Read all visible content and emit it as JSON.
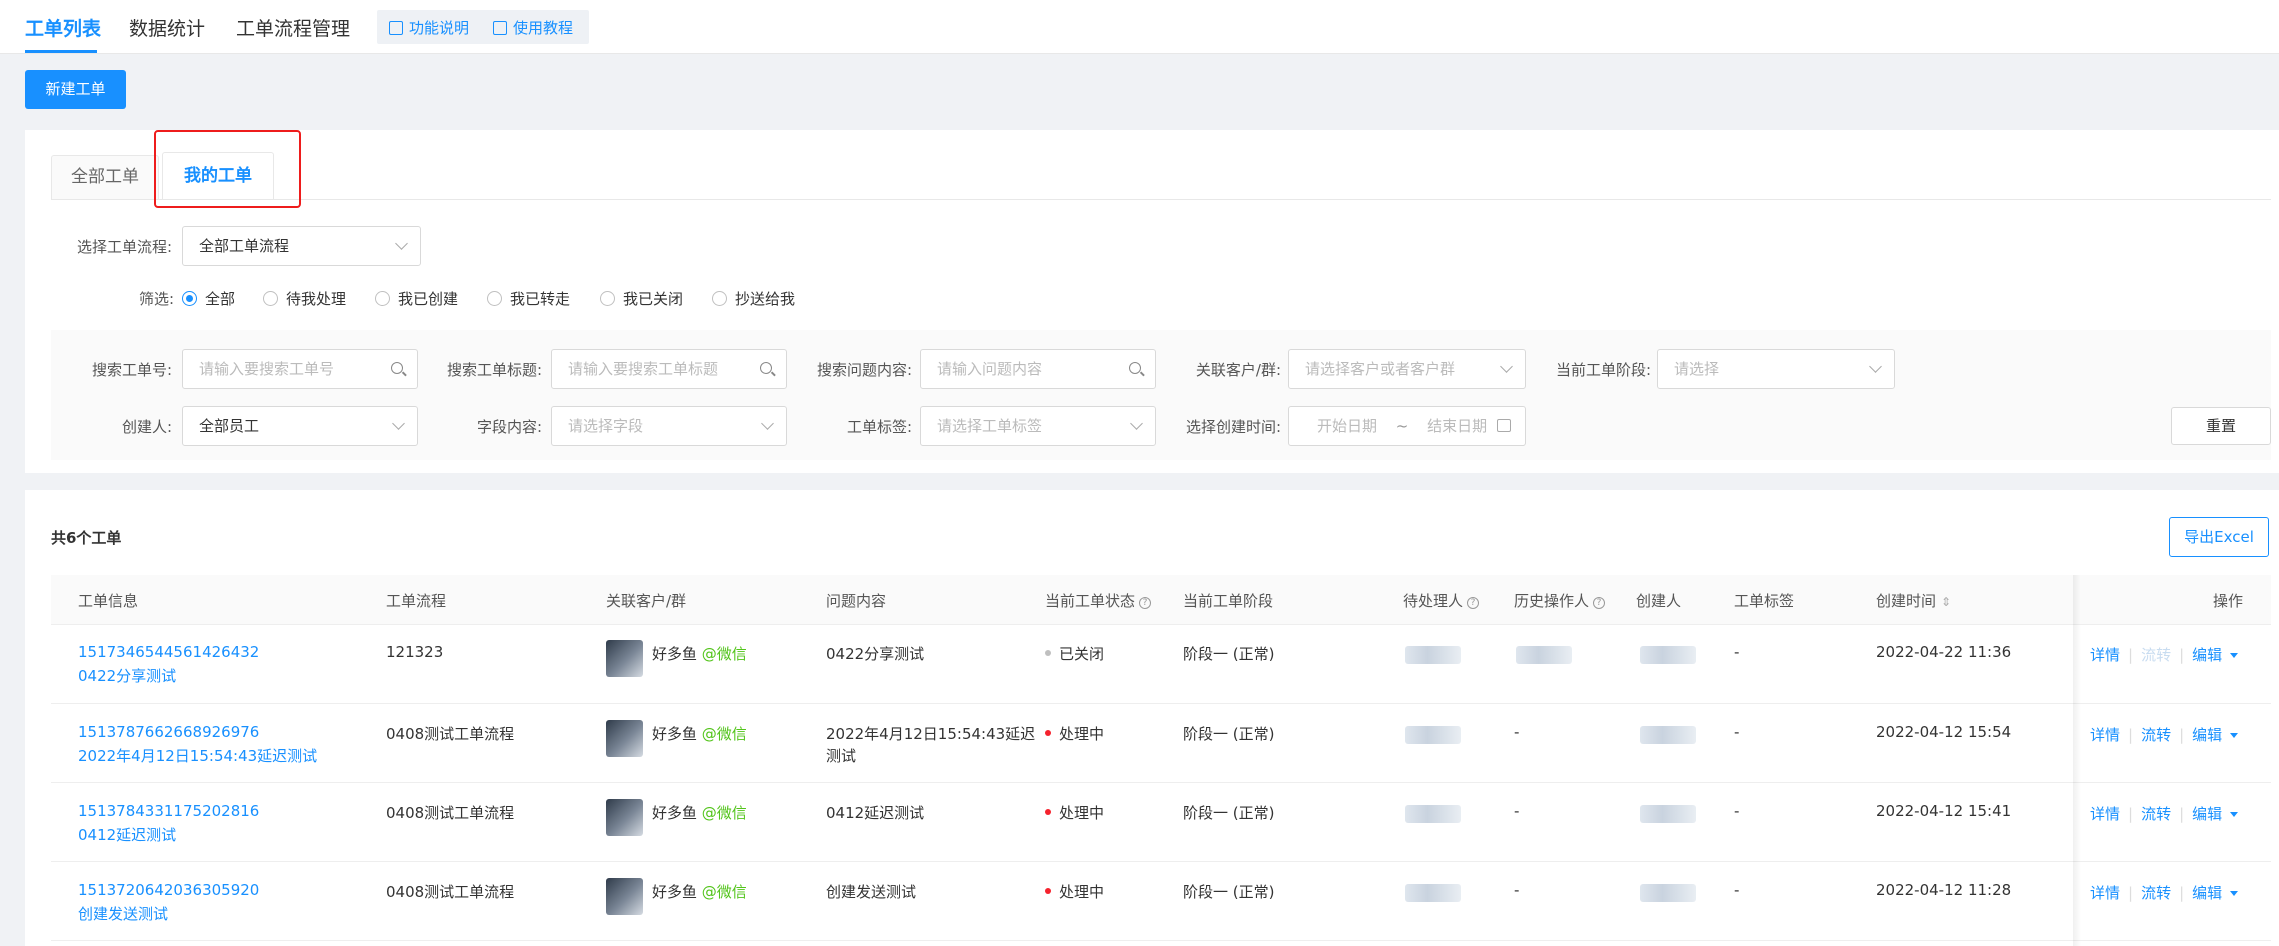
{
  "nav": {
    "tabs": [
      "工单列表",
      "数据统计",
      "工单流程管理"
    ],
    "help_links": [
      "功能说明",
      "使用教程"
    ]
  },
  "new_button": "新建工单",
  "view_tabs": [
    "全部工单",
    "我的工单"
  ],
  "process": {
    "label": "选择工单流程:",
    "value": "全部工单流程"
  },
  "filter": {
    "label": "筛选:",
    "options": [
      "全部",
      "待我处理",
      "我已创建",
      "我已转走",
      "我已关闭",
      "抄送给我"
    ],
    "selected": "全部"
  },
  "search": {
    "order_no": {
      "label": "搜索工单号:",
      "placeholder": "请输入要搜索工单号"
    },
    "title": {
      "label": "搜索工单标题:",
      "placeholder": "请输入要搜索工单标题"
    },
    "content": {
      "label": "搜索问题内容:",
      "placeholder": "请输入问题内容"
    },
    "customer": {
      "label": "关联客户/群:",
      "placeholder": "请选择客户或者客户群"
    },
    "stage": {
      "label": "当前工单阶段:",
      "placeholder": "请选择"
    },
    "creator": {
      "label": "创建人:",
      "value": "全部员工"
    },
    "field": {
      "label": "字段内容:",
      "placeholder": "请选择字段"
    },
    "tag": {
      "label": "工单标签:",
      "placeholder": "请选择工单标签"
    },
    "date": {
      "label": "选择创建时间:",
      "start": "开始日期",
      "sep": "~",
      "end": "结束日期"
    },
    "reset": "重置"
  },
  "list": {
    "total": "共6个工单",
    "export": "导出Excel",
    "columns": [
      "工单信息",
      "工单流程",
      "关联客户/群",
      "问题内容",
      "当前工单状态",
      "当前工单阶段",
      "待处理人",
      "历史操作人",
      "创建人",
      "工单标签",
      "创建时间",
      "操作"
    ],
    "rows": [
      {
        "id": "1517346544561426432",
        "title": "0422分享测试",
        "process": "121323",
        "customer": "好多鱼",
        "channel": "@微信",
        "content1": "0422分享测试",
        "content2": "",
        "status": "已关闭",
        "status_color": "#bfbfbf",
        "stage": "阶段一 (正常)",
        "history": "",
        "tag": "-",
        "time": "2022-04-22 11:36"
      },
      {
        "id": "1513787662668926976",
        "title": "2022年4月12日15:54:43延迟测试",
        "process": "0408测试工单流程",
        "customer": "好多鱼",
        "channel": "@微信",
        "content1": "2022年4月12日15:54:43延迟",
        "content2": "测试",
        "status": "处理中",
        "status_color": "#f5222d",
        "stage": "阶段一 (正常)",
        "history": "-",
        "tag": "-",
        "time": "2022-04-12 15:54"
      },
      {
        "id": "1513784331175202816",
        "title": "0412延迟测试",
        "process": "0408测试工单流程",
        "customer": "好多鱼",
        "channel": "@微信",
        "content1": "0412延迟测试",
        "content2": "",
        "status": "处理中",
        "status_color": "#f5222d",
        "stage": "阶段一 (正常)",
        "history": "-",
        "tag": "-",
        "time": "2022-04-12 15:41"
      },
      {
        "id": "1513720642036305920",
        "title": "创建发送测试",
        "process": "0408测试工单流程",
        "customer": "好多鱼",
        "channel": "@微信",
        "content1": "创建发送测试",
        "content2": "",
        "status": "处理中",
        "status_color": "#f5222d",
        "stage": "阶段一 (正常)",
        "history": "-",
        "tag": "-",
        "time": "2022-04-12 11:28"
      }
    ],
    "actions": [
      "详情",
      "流转",
      "编辑"
    ]
  }
}
